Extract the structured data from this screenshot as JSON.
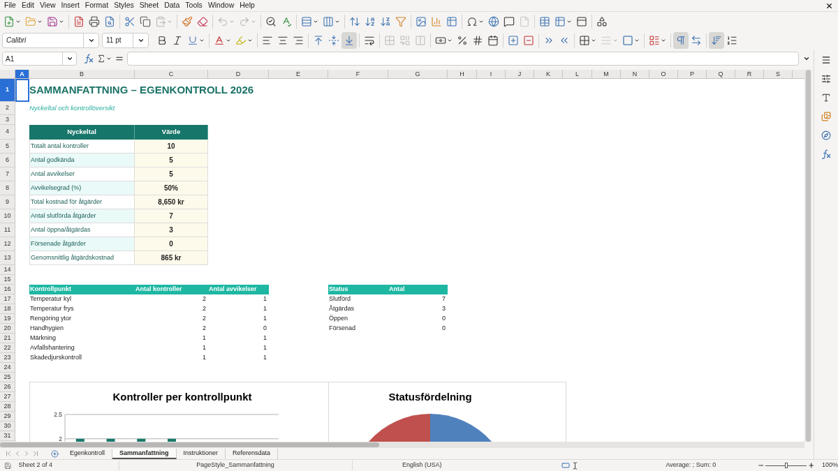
{
  "menu": [
    "File",
    "Edit",
    "View",
    "Insert",
    "Format",
    "Styles",
    "Sheet",
    "Data",
    "Tools",
    "Window",
    "Help"
  ],
  "toolbar_standard": [
    [
      {
        "kind": "new",
        "disabled": false
      },
      {
        "kind": "open",
        "disabled": false
      },
      {
        "kind": "save",
        "disabled": false
      }
    ],
    [
      {
        "kind": "pdf",
        "disabled": false
      },
      {
        "kind": "print",
        "disabled": false
      },
      {
        "kind": "preview",
        "disabled": false
      }
    ],
    [
      {
        "kind": "cut",
        "disabled": false
      },
      {
        "kind": "copy",
        "disabled": false
      },
      {
        "kind": "paste",
        "disabled": true
      }
    ],
    [
      {
        "kind": "clone",
        "disabled": false
      },
      {
        "kind": "clear",
        "disabled": false
      }
    ],
    [
      {
        "kind": "undo",
        "disabled": true
      },
      {
        "kind": "redo",
        "disabled": true
      }
    ],
    [
      {
        "kind": "find",
        "disabled": false
      },
      {
        "kind": "spelling",
        "disabled": false
      }
    ],
    [
      {
        "kind": "row",
        "disabled": false
      },
      {
        "kind": "column",
        "disabled": false
      }
    ],
    [
      {
        "kind": "sort",
        "disabled": false
      },
      {
        "kind": "ascending",
        "disabled": false
      },
      {
        "kind": "descending",
        "disabled": false
      },
      {
        "kind": "filter",
        "disabled": false
      }
    ],
    [
      {
        "kind": "image",
        "disabled": false
      },
      {
        "kind": "chart",
        "disabled": false
      },
      {
        "kind": "pivot",
        "disabled": false
      }
    ],
    [
      {
        "kind": "special",
        "disabled": false
      },
      {
        "kind": "link",
        "disabled": false
      },
      {
        "kind": "comment",
        "disabled": false
      },
      {
        "kind": "header",
        "disabled": true
      }
    ],
    [
      {
        "kind": "printarea",
        "disabled": false
      },
      {
        "kind": "freeze",
        "disabled": false
      },
      {
        "kind": "split",
        "disabled": false
      }
    ],
    [
      {
        "kind": "shapes",
        "disabled": false
      }
    ]
  ],
  "font_name": "Calibri",
  "font_size": "11 pt",
  "toolbar_format": [
    [
      {
        "kind": "bold",
        "on": false,
        "disabled": false
      },
      {
        "kind": "italic",
        "on": false,
        "disabled": false
      },
      {
        "kind": "underline",
        "on": false,
        "disabled": false
      }
    ],
    [
      {
        "kind": "fontcolor",
        "on": false,
        "disabled": false
      },
      {
        "kind": "highlight",
        "on": false,
        "disabled": false
      }
    ],
    [
      {
        "kind": "left",
        "on": false,
        "disabled": false
      },
      {
        "kind": "center",
        "on": false,
        "disabled": false
      },
      {
        "kind": "right",
        "on": false,
        "disabled": false
      }
    ],
    [
      {
        "kind": "top",
        "on": false,
        "disabled": false
      },
      {
        "kind": "middle",
        "on": false,
        "disabled": false
      },
      {
        "kind": "bottom",
        "on": true,
        "disabled": false
      }
    ],
    [
      {
        "kind": "wrap",
        "on": false,
        "disabled": false
      }
    ],
    [
      {
        "kind": "merge",
        "on": false,
        "disabled": true
      },
      {
        "kind": "mergecenter",
        "on": false,
        "disabled": true
      },
      {
        "kind": "unmerge",
        "on": false,
        "disabled": true
      }
    ],
    [
      {
        "kind": "currency",
        "on": false,
        "disabled": false
      },
      {
        "kind": "percent",
        "on": false,
        "disabled": false
      },
      {
        "kind": "number",
        "on": false,
        "disabled": false
      },
      {
        "kind": "date",
        "on": false,
        "disabled": false
      }
    ],
    [
      {
        "kind": "adddecimal",
        "on": false,
        "disabled": false
      },
      {
        "kind": "deldecimal",
        "on": false,
        "disabled": false
      }
    ],
    [
      {
        "kind": "indent",
        "on": false,
        "disabled": false
      },
      {
        "kind": "outdent",
        "on": false,
        "disabled": false
      }
    ],
    [
      {
        "kind": "borders",
        "on": false,
        "disabled": false
      },
      {
        "kind": "borderstyle",
        "on": false,
        "disabled": true
      },
      {
        "kind": "bordercolor",
        "on": false,
        "disabled": false
      }
    ],
    [
      {
        "kind": "conditional",
        "on": false,
        "disabled": false
      }
    ],
    [
      {
        "kind": "ltr",
        "on": true,
        "disabled": false
      },
      {
        "kind": "rtl",
        "on": false,
        "disabled": false
      }
    ],
    [
      {
        "kind": "stacked",
        "on": true,
        "disabled": false
      },
      {
        "kind": "sortcolumn",
        "on": false,
        "disabled": false
      }
    ]
  ],
  "name_box": "A1",
  "columns": [
    {
      "label": "A",
      "selected": true
    },
    {
      "label": "B",
      "selected": false
    },
    {
      "label": "C",
      "selected": false
    },
    {
      "label": "D",
      "selected": false
    },
    {
      "label": "E",
      "selected": false
    },
    {
      "label": "F",
      "selected": false
    },
    {
      "label": "G",
      "selected": false
    },
    {
      "label": "H",
      "selected": false
    },
    {
      "label": "I",
      "selected": false
    },
    {
      "label": "J",
      "selected": false
    },
    {
      "label": "K",
      "selected": false
    },
    {
      "label": "L",
      "selected": false
    },
    {
      "label": "M",
      "selected": false
    },
    {
      "label": "N",
      "selected": false
    },
    {
      "label": "O",
      "selected": false
    },
    {
      "label": "P",
      "selected": false
    },
    {
      "label": "Q",
      "selected": false
    },
    {
      "label": "R",
      "selected": false
    },
    {
      "label": "S",
      "selected": false
    }
  ],
  "rows": [
    {
      "label": "1",
      "selected": true
    },
    {
      "label": "2",
      "selected": false
    },
    {
      "label": "3",
      "selected": false
    },
    {
      "label": "4",
      "selected": false
    },
    {
      "label": "5",
      "selected": false
    },
    {
      "label": "6",
      "selected": false
    },
    {
      "label": "7",
      "selected": false
    },
    {
      "label": "8",
      "selected": false
    },
    {
      "label": "9",
      "selected": false
    },
    {
      "label": "10",
      "selected": false
    },
    {
      "label": "11",
      "selected": false
    },
    {
      "label": "12",
      "selected": false
    },
    {
      "label": "13",
      "selected": false
    },
    {
      "label": "14",
      "selected": false
    },
    {
      "label": "15",
      "selected": false
    },
    {
      "label": "16",
      "selected": false
    },
    {
      "label": "17",
      "selected": false
    },
    {
      "label": "18",
      "selected": false
    },
    {
      "label": "19",
      "selected": false
    },
    {
      "label": "20",
      "selected": false
    },
    {
      "label": "21",
      "selected": false
    },
    {
      "label": "22",
      "selected": false
    },
    {
      "label": "23",
      "selected": false
    },
    {
      "label": "24",
      "selected": false
    },
    {
      "label": "25",
      "selected": false
    },
    {
      "label": "26",
      "selected": false
    },
    {
      "label": "27",
      "selected": false
    },
    {
      "label": "28",
      "selected": false
    },
    {
      "label": "29",
      "selected": false
    },
    {
      "label": "30",
      "selected": false
    },
    {
      "label": "31",
      "selected": false
    }
  ],
  "title": "SAMMANFATTNING – EGENKONTROLL 2026",
  "subtitle": "Nyckeltal och kontrollöversikt",
  "kpi_table": {
    "columns": [
      "Nyckeltal",
      "Värde"
    ],
    "rows": [
      {
        "label": "Totalt antal kontroller",
        "value": "10"
      },
      {
        "label": "Antal godkända",
        "value": "5"
      },
      {
        "label": "Antal avvikelser",
        "value": "5"
      },
      {
        "label": "Avvikelsegrad (%)",
        "value": "50%"
      },
      {
        "label": "Total kostnad för åtgärder",
        "value": "8,650 kr"
      },
      {
        "label": "Antal slutförda åtgärder",
        "value": "7"
      },
      {
        "label": "Antal öppna/åtgärdas",
        "value": "3"
      },
      {
        "label": "Försenade åtgärder",
        "value": "0"
      },
      {
        "label": "Genomsnittlig åtgärdskostnad",
        "value": "865 kr"
      }
    ]
  },
  "control_table": {
    "columns": [
      "Kontrollpunkt",
      "Antal kontroller",
      "Antal avvikelser"
    ],
    "rows": [
      [
        "Temperatur kyl",
        "2",
        "1"
      ],
      [
        "Temperatur frys",
        "2",
        "1"
      ],
      [
        "Rengöring ytor",
        "2",
        "1"
      ],
      [
        "Handhygien",
        "2",
        "0"
      ],
      [
        "Märkning",
        "1",
        "1"
      ],
      [
        "Avfallshantering",
        "1",
        "1"
      ],
      [
        "Skadedjurskontroll",
        "1",
        "1"
      ]
    ]
  },
  "status_table": {
    "columns": [
      "Status",
      "Antal"
    ],
    "rows": [
      [
        "Slutförd",
        "7"
      ],
      [
        "Åtgärdas",
        "3"
      ],
      [
        "Öppen",
        "0"
      ],
      [
        "Försenad",
        "0"
      ]
    ]
  },
  "bar_chart": {
    "chart_data": {
      "type": "bar",
      "title": "Kontroller per kontrollpunkt",
      "values": [
        2,
        2,
        2,
        2,
        null,
        null,
        null
      ],
      "ylim": [
        1.94,
        2.5
      ],
      "yticks": [
        2,
        2.5
      ]
    }
  },
  "pie_chart": {
    "title": "Statusfördelning"
  },
  "sheet_tabs": [
    {
      "label": "Egenkontroll",
      "selected": false
    },
    {
      "label": "Sammanfattning",
      "selected": true
    },
    {
      "label": "Instruktioner",
      "selected": false
    },
    {
      "label": "Referensdata",
      "selected": false
    }
  ],
  "status_bar": {
    "sheet": "Sheet 2 of 4",
    "page_style": "PageStyle_Sammanfattning",
    "language": "English (USA)",
    "summary": "Average: ; Sum: 0",
    "zoom": "100%",
    "zoom_slider": {
      "level": 0.5
    }
  }
}
